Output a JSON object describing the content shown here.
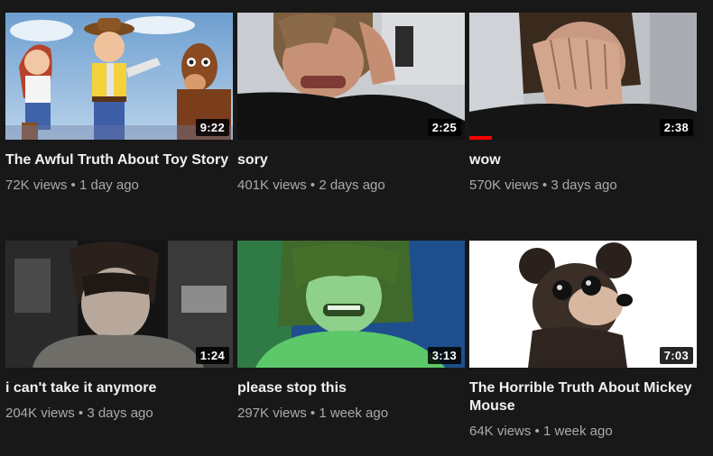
{
  "videos": [
    {
      "title": "The Awful Truth About Toy Story",
      "views": "72K views",
      "age": "1 day ago",
      "duration": "9:22",
      "thumbnail": "toy-story-characters"
    },
    {
      "title": "sory",
      "views": "401K views",
      "age": "2 days ago",
      "duration": "2:25",
      "thumbnail": "man-hand-in-hair"
    },
    {
      "title": "wow",
      "views": "570K views",
      "age": "3 days ago",
      "duration": "2:38",
      "thumbnail": "man-facepalm",
      "watched_fraction": 0.1
    },
    {
      "title": "i can't take it anymore",
      "views": "204K views",
      "age": "3 days ago",
      "duration": "1:24",
      "thumbnail": "man-looking-down-studio"
    },
    {
      "title": "please stop this",
      "views": "297K views",
      "age": "1 week ago",
      "duration": "3:13",
      "thumbnail": "man-crying-green-light"
    },
    {
      "title": "The Horrible Truth About Mickey Mouse",
      "views": "64K views",
      "age": "1 week ago",
      "duration": "7:03",
      "thumbnail": "creepy-mouse-toy"
    }
  ],
  "separator": "•",
  "colors": {
    "background": "#181818",
    "title": "#f1f1f1",
    "meta": "#aaaaaa",
    "progress": "#ff0000"
  }
}
